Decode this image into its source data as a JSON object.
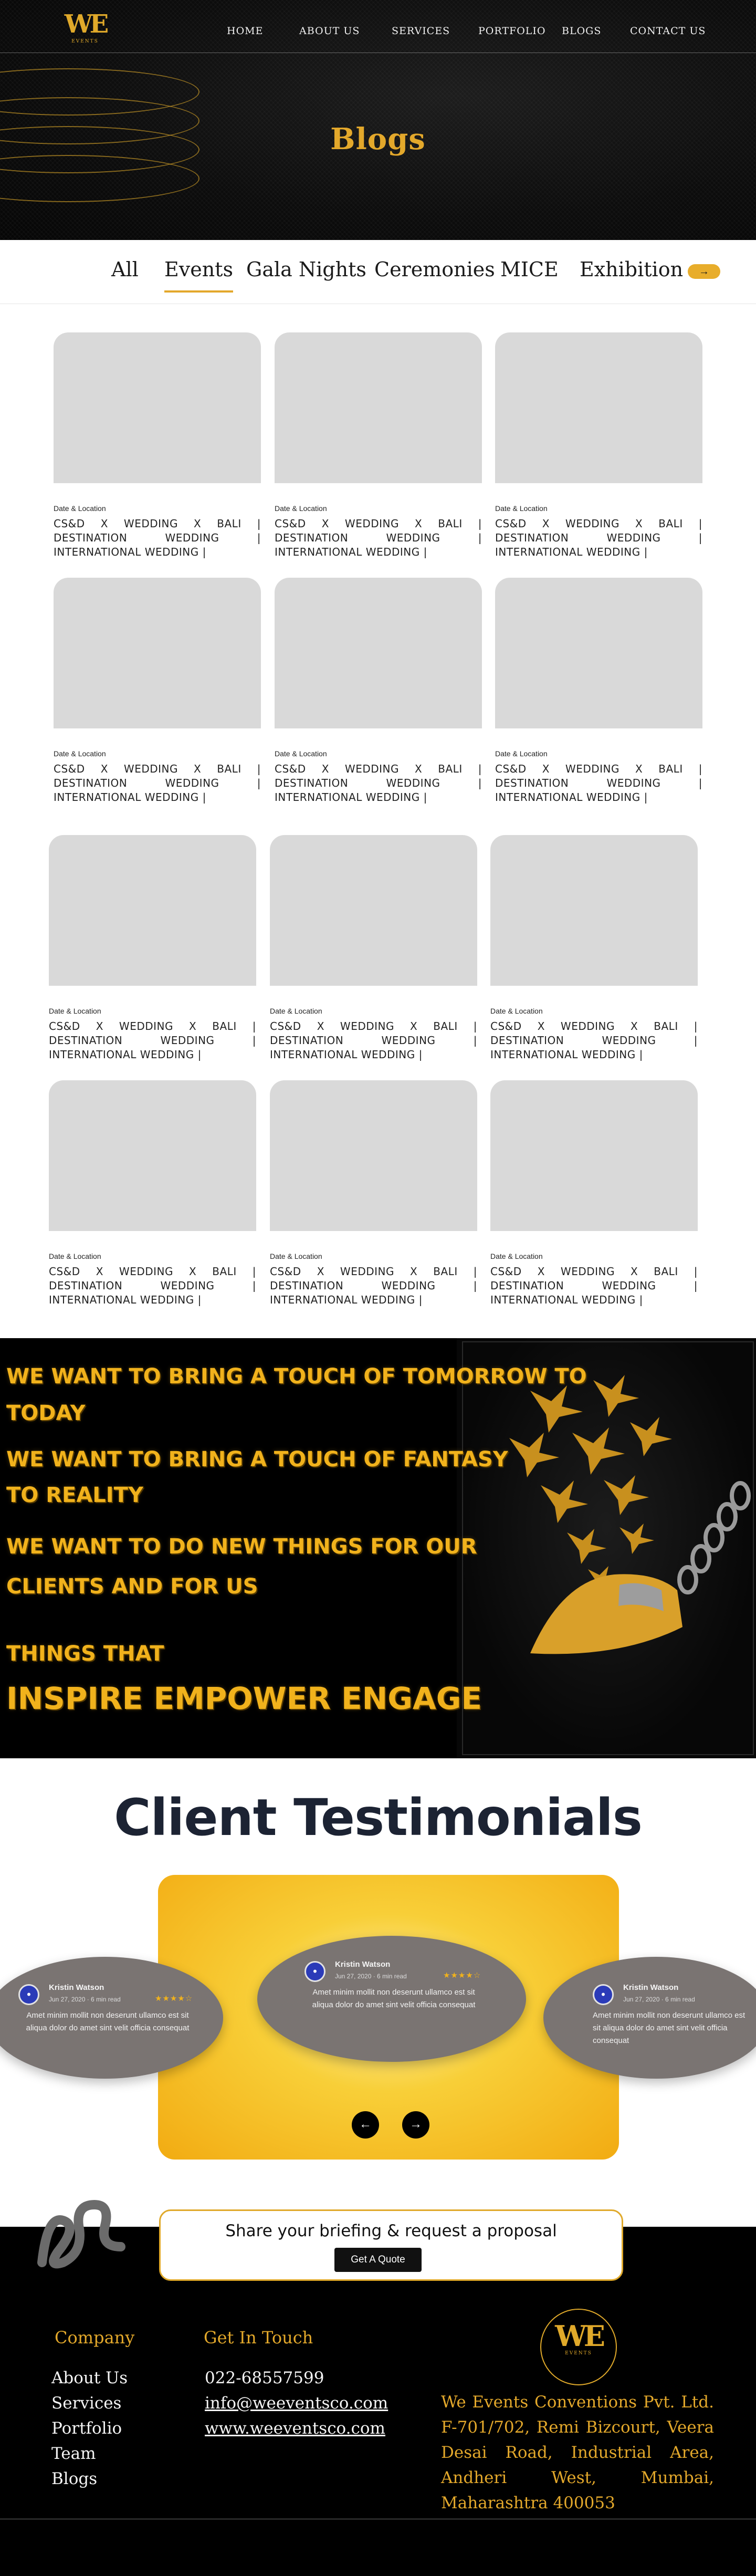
{
  "header": {
    "logo": {
      "mark": "WE",
      "sub": "EVENTS"
    },
    "nav": [
      "HOME",
      "ABOUT US",
      "SERVICES",
      "PORTFOLIO",
      "BLOGS",
      "CONTACT US"
    ],
    "title": "Blogs"
  },
  "tabs": {
    "items": [
      "All",
      "Events",
      "Gala Nights",
      "Ceremonies",
      "MICE",
      "Exhibition"
    ],
    "active": "Events",
    "arrow": "→"
  },
  "blog_cards": [
    {
      "meta": "Date & Location",
      "title": "CS&D X WEDDING X BALI | DESTINATION WEDDING | INTERNATIONAL WEDDING |"
    },
    {
      "meta": "Date & Location",
      "title": "CS&D X WEDDING X BALI | DESTINATION WEDDING | INTERNATIONAL WEDDING |"
    },
    {
      "meta": "Date & Location",
      "title": "CS&D X WEDDING X BALI | DESTINATION WEDDING | INTERNATIONAL WEDDING |"
    },
    {
      "meta": "Date & Location",
      "title": "CS&D X WEDDING X BALI | DESTINATION WEDDING | INTERNATIONAL WEDDING |"
    },
    {
      "meta": "Date & Location",
      "title": "CS&D X WEDDING X BALI | DESTINATION WEDDING | INTERNATIONAL WEDDING |"
    },
    {
      "meta": "Date & Location",
      "title": "CS&D X WEDDING X BALI | DESTINATION WEDDING | INTERNATIONAL WEDDING |"
    },
    {
      "meta": "Date & Location",
      "title": "CS&D X WEDDING X BALI | DESTINATION WEDDING | INTERNATIONAL WEDDING |"
    },
    {
      "meta": "Date & Location",
      "title": "CS&D X WEDDING X BALI | DESTINATION WEDDING | INTERNATIONAL WEDDING |"
    },
    {
      "meta": "Date & Location",
      "title": "CS&D X WEDDING X BALI | DESTINATION WEDDING | INTERNATIONAL WEDDING |"
    },
    {
      "meta": "Date & Location",
      "title": "CS&D X WEDDING X BALI | DESTINATION WEDDING | INTERNATIONAL WEDDING |"
    },
    {
      "meta": "Date & Location",
      "title": "CS&D X WEDDING X BALI | DESTINATION WEDDING | INTERNATIONAL WEDDING |"
    },
    {
      "meta": "Date & Location",
      "title": "CS&D X WEDDING X BALI | DESTINATION WEDDING | INTERNATIONAL WEDDING |"
    }
  ],
  "banner": {
    "lines": [
      "WE WANT TO BRING A TOUCH OF TOMORROW TO",
      "TODAY",
      "WE WANT TO BRING A TOUCH OF FANTASY",
      "TO REALITY",
      "WE WANT TO DO NEW THINGS FOR OUR",
      "CLIENTS AND FOR US",
      "THINGS THAT",
      "INSPIRE EMPOWER ENGAGE"
    ]
  },
  "testimonials": {
    "title": "Client Testimonials",
    "items": [
      {
        "name": "Kristin Watson",
        "date": "Jun 27, 2020 · 6 min read",
        "stars": "★★★★☆",
        "text": "Amet minim mollit non deserunt ullamco est sit aliqua dolor do amet sint velit officia consequat"
      },
      {
        "name": "Kristin Watson",
        "date": "Jun 27, 2020 · 6 min read",
        "stars": "★★★★☆",
        "text": "Amet minim mollit non deserunt ullamco est sit aliqua dolor do amet sint velit officia consequat"
      },
      {
        "name": "Kristin Watson",
        "date": "Jun 27, 2020 · 6 min read",
        "stars": "★★★★☆",
        "text": "Amet minim mollit non deserunt ullamco est sit aliqua dolor do amet sint velit officia consequat"
      }
    ],
    "prev": "←",
    "next": "→"
  },
  "proposal": {
    "text": "Share your briefing & request a proposal",
    "button": "Get A Quote"
  },
  "footer": {
    "company_heading": "Company",
    "company_links": [
      "About Us",
      "Services",
      "Portfolio",
      "Team",
      "Blogs"
    ],
    "contact_heading": "Get In Touch",
    "phone": "022-68557599",
    "email": "info@weeventsco.com",
    "website": "www.weeventsco.com",
    "logo": {
      "mark": "WE",
      "sub": "EVENTS"
    },
    "address": "We Events Conventions Pvt. Ltd. F-701/702, Remi Bizcourt, Veera Desai Road, Industrial Area, Andheri West, Mumbai, Maharashtra 400053"
  },
  "colors": {
    "gold": "#e3a82b",
    "dark": "#000000",
    "navy": "#1c2333"
  }
}
